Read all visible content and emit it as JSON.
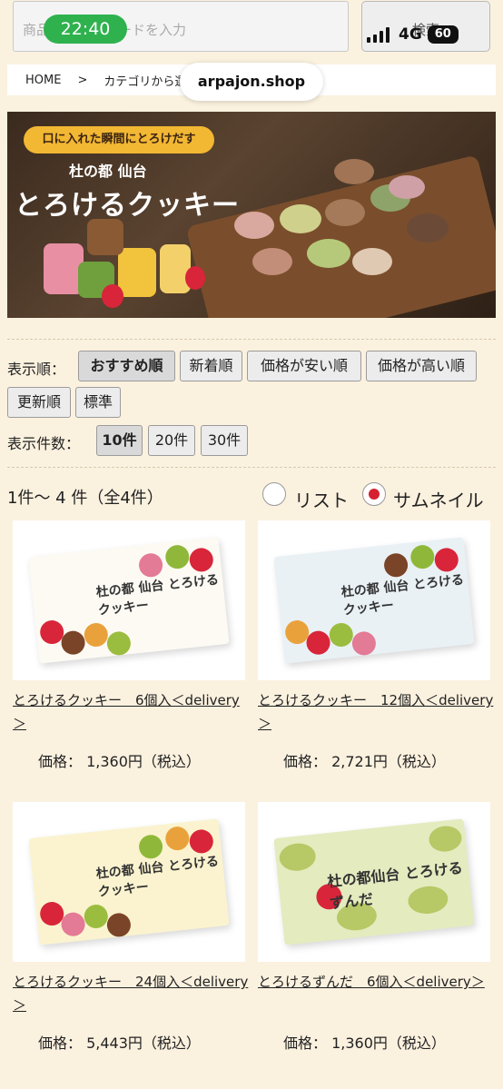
{
  "header": {
    "search_placeholder": "商品名・キーワードを入力",
    "search_button": "検索",
    "time": "22:40",
    "network": "4G",
    "battery": "60",
    "domain": "arpajon.shop"
  },
  "breadcrumb": {
    "home": "HOME",
    "sep": ">",
    "current": "カテゴリから選ぶ"
  },
  "banner": {
    "tagline": "口に入れた瞬間にとろけだす",
    "subtitle": "杜の都 仙台",
    "title": "とろけるクッキー"
  },
  "sort": {
    "label": "表示順：",
    "options": [
      "おすすめ順",
      "新着順",
      "価格が安い順",
      "価格が高い順",
      "更新順",
      "標準"
    ],
    "selected": "おすすめ順"
  },
  "per_page": {
    "label": "表示件数：",
    "options": [
      "10件",
      "20件",
      "30件"
    ],
    "selected": "10件"
  },
  "results": {
    "count_text": "1件〜 4 件（全4件）"
  },
  "view": {
    "list_label": "リスト",
    "thumb_label": "サムネイル",
    "selected": "サムネイル"
  },
  "products": [
    {
      "name": "とろけるクッキー　6個入＜delivery＞",
      "price": "価格： 1,360円（税込）",
      "box_color": "#fdfaf4"
    },
    {
      "name": "とろけるクッキー　12個入＜delivery＞",
      "price": "価格： 2,721円（税込）",
      "box_color": "#e9f1f5"
    },
    {
      "name": "とろけるクッキー　24個入＜delivery＞",
      "price": "価格： 5,443円（税込）",
      "box_color": "#fbf3cf"
    },
    {
      "name": "とろけるずんだ　6個入＜delivery＞",
      "price": "価格： 1,360円（税込）",
      "box_color": "#e4ebbf"
    }
  ],
  "box_labels": [
    "杜の都 仙台 とろけるクッキー",
    "杜の都 仙台 とろけるクッキー",
    "杜の都 仙台 とろけるクッキー",
    "杜の都仙台 とろけるずんだ"
  ]
}
